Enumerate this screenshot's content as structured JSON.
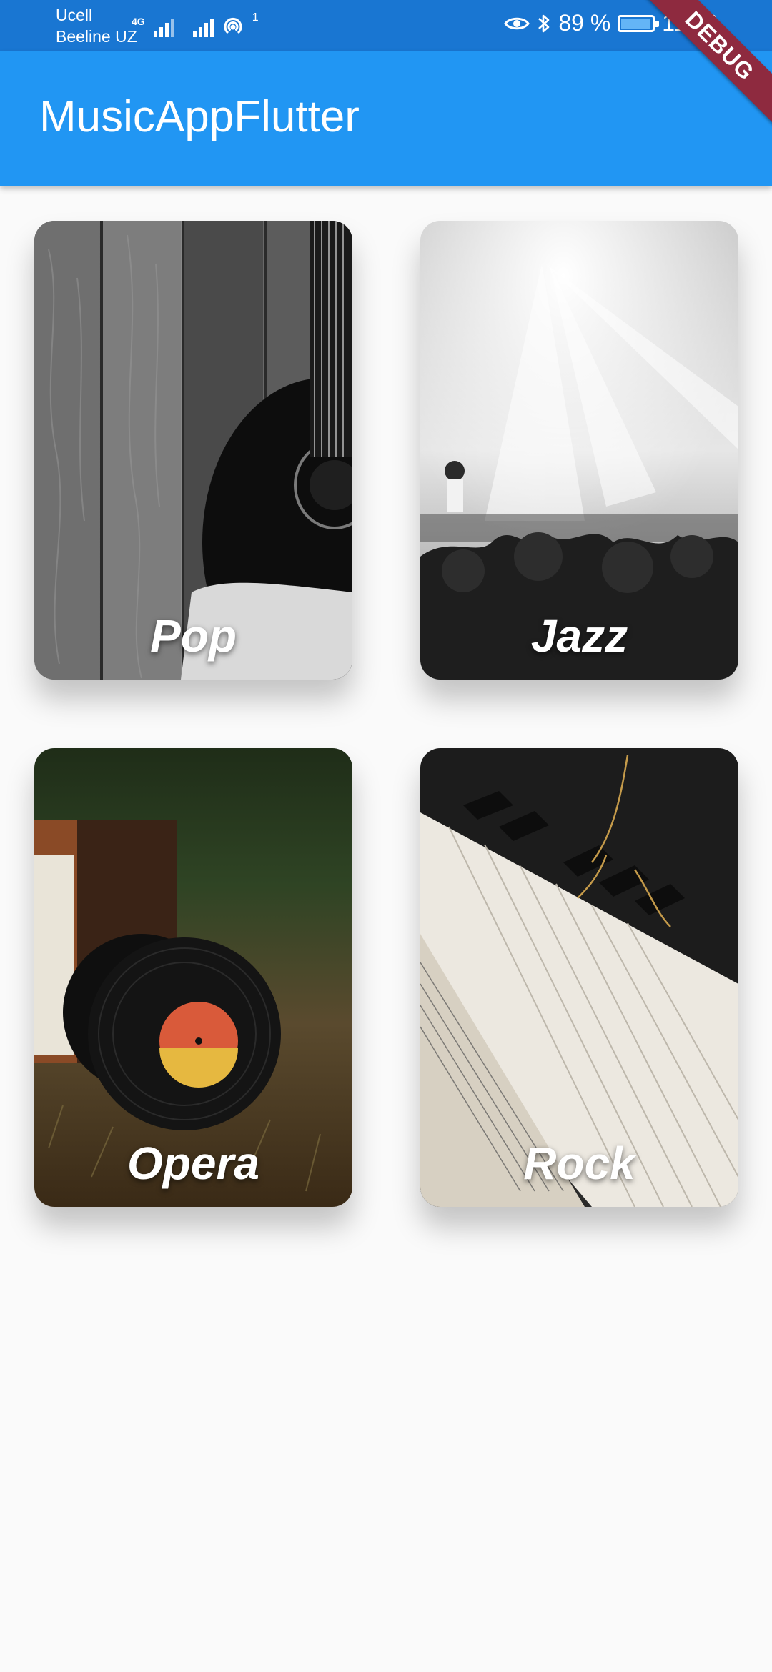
{
  "status_bar": {
    "carrier_1": "Ucell",
    "carrier_2": "Beeline UZ",
    "network_type": "4G",
    "hotspot_count": "1",
    "battery_text": "89 %",
    "battery_level": 0.89,
    "time": "11:08",
    "icons": [
      "signal-icon",
      "hotspot-icon",
      "eye-icon",
      "bluetooth-icon",
      "battery-icon"
    ]
  },
  "app_bar": {
    "title": "MusicAppFlutter"
  },
  "debug_banner": "DEBUG",
  "genres": [
    {
      "label": "Pop",
      "image": "guitar-on-wood-photo"
    },
    {
      "label": "Jazz",
      "image": "concert-stage-lights-photo"
    },
    {
      "label": "Opera",
      "image": "vinyl-records-on-grass-photo"
    },
    {
      "label": "Rock",
      "image": "piano-keys-sheet-music-photo"
    }
  ],
  "colors": {
    "app_bar": "#2196f3",
    "status_bar": "#1976d2",
    "background": "#fafafa",
    "debug_banner": "#8e2a3f"
  }
}
